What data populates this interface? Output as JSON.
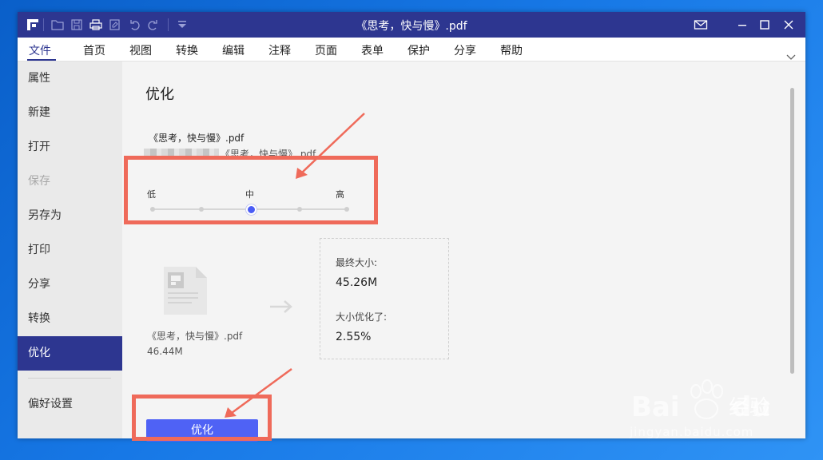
{
  "window": {
    "title": "《思考，快与慢》.pdf"
  },
  "menu": {
    "items": [
      "文件",
      "首页",
      "视图",
      "转换",
      "编辑",
      "注释",
      "页面",
      "表单",
      "保护",
      "分享",
      "帮助"
    ],
    "active": "文件"
  },
  "sidebar": {
    "items": [
      {
        "label": "属性",
        "state": "normal"
      },
      {
        "label": "新建",
        "state": "normal"
      },
      {
        "label": "打开",
        "state": "normal"
      },
      {
        "label": "保存",
        "state": "disabled"
      },
      {
        "label": "另存为",
        "state": "normal"
      },
      {
        "label": "打印",
        "state": "normal"
      },
      {
        "label": "分享",
        "state": "normal"
      },
      {
        "label": "转换",
        "state": "normal"
      },
      {
        "label": "优化",
        "state": "active"
      }
    ],
    "preferences": "偏好设置"
  },
  "optimize": {
    "heading": "优化",
    "file_name": "《思考，快与慢》.pdf",
    "file_path_suffix": "《思考，快与慢》.pdf",
    "level_low": "低",
    "level_mid": "中",
    "level_high": "高",
    "selected_level": "中",
    "source_name": "《思考，快与慢》.pdf",
    "source_size": "46.44M",
    "final_size_label": "最终大小:",
    "final_size_value": "45.26M",
    "reduced_label": "大小优化了:",
    "reduced_value": "2.55%",
    "button_label": "优化"
  },
  "watermark": {
    "brand": "Bai",
    "brand2": "du",
    "cn": "经验",
    "url": "jingyan.baidu.com"
  },
  "colors": {
    "titlebar": "#2d3690",
    "accent": "#4f62f5",
    "annotation": "#ef6a5a"
  }
}
